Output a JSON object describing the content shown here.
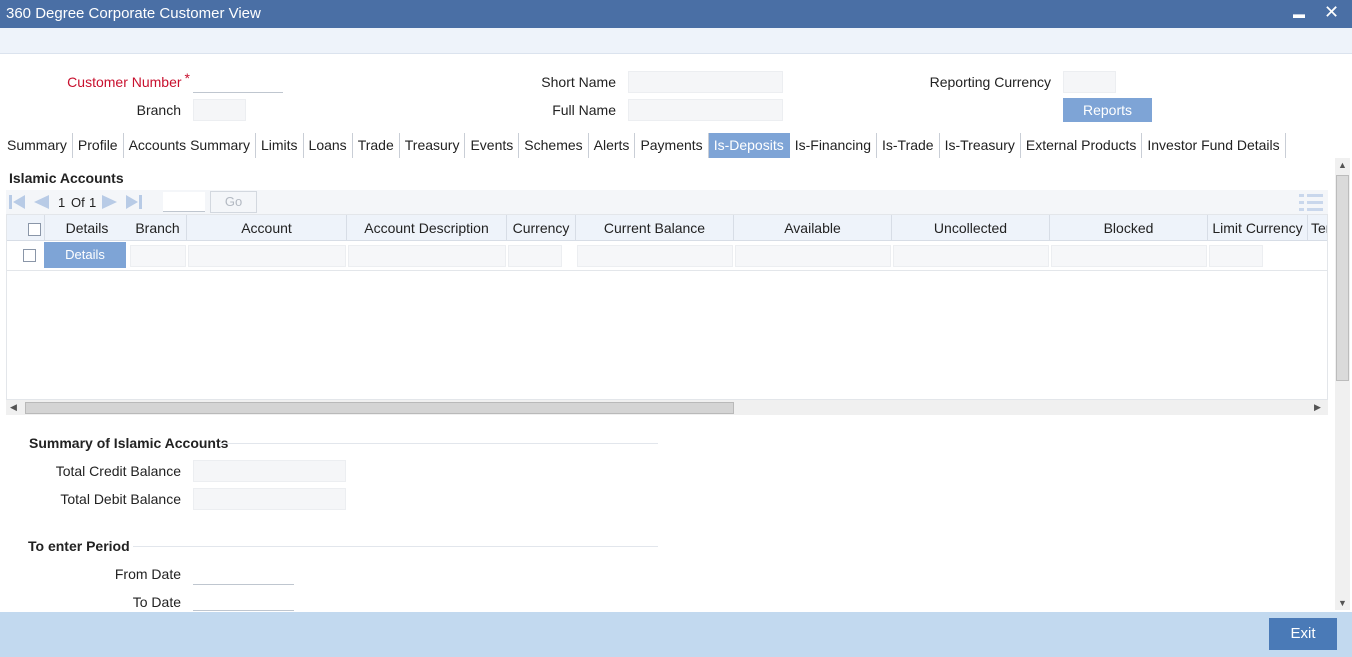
{
  "window": {
    "title": "360 Degree Corporate Customer View",
    "minimize": "▬",
    "close": "✕"
  },
  "header": {
    "customer_number_label": "Customer Number",
    "required_mark": "*",
    "customer_number_value": "",
    "branch_label": "Branch",
    "branch_value": "",
    "short_name_label": "Short Name",
    "short_name_value": "",
    "full_name_label": "Full Name",
    "full_name_value": "",
    "reporting_currency_label": "Reporting Currency",
    "reporting_currency_value": "",
    "reports_button": "Reports"
  },
  "tabs": [
    "Summary",
    "Profile",
    "Accounts Summary",
    "Limits",
    "Loans",
    "Trade",
    "Treasury",
    "Events",
    "Schemes",
    "Alerts",
    "Payments",
    "Is-Deposits",
    "Is-Financing",
    "Is-Trade",
    "Is-Treasury",
    "External Products",
    "Investor Fund Details"
  ],
  "active_tab": "Is-Deposits",
  "islamic_accounts": {
    "title": "Islamic Accounts",
    "pagination": {
      "current": "1",
      "of_label": "Of",
      "total": "1",
      "go_button": "Go",
      "page_input": ""
    },
    "columns": [
      "Details",
      "Branch",
      "Account",
      "Account Description",
      "Currency",
      "Current Balance",
      "Available",
      "Uncollected",
      "Blocked",
      "Limit Currency",
      "Ten"
    ],
    "rows": [
      {
        "details_button": "Details"
      }
    ]
  },
  "summary": {
    "title": "Summary of Islamic Accounts",
    "total_credit_label": "Total Credit Balance",
    "total_credit_value": "",
    "total_debit_label": "Total Debit Balance",
    "total_debit_value": ""
  },
  "period": {
    "title": "To enter Period",
    "from_label": "From Date",
    "from_value": "",
    "to_label": "To Date",
    "to_value": ""
  },
  "footer": {
    "exit_button": "Exit"
  },
  "colors": {
    "titlebar": "#4a6fa5",
    "accent": "#7ea4d6",
    "footer": "#c2d9ef",
    "required": "#c8102e"
  }
}
